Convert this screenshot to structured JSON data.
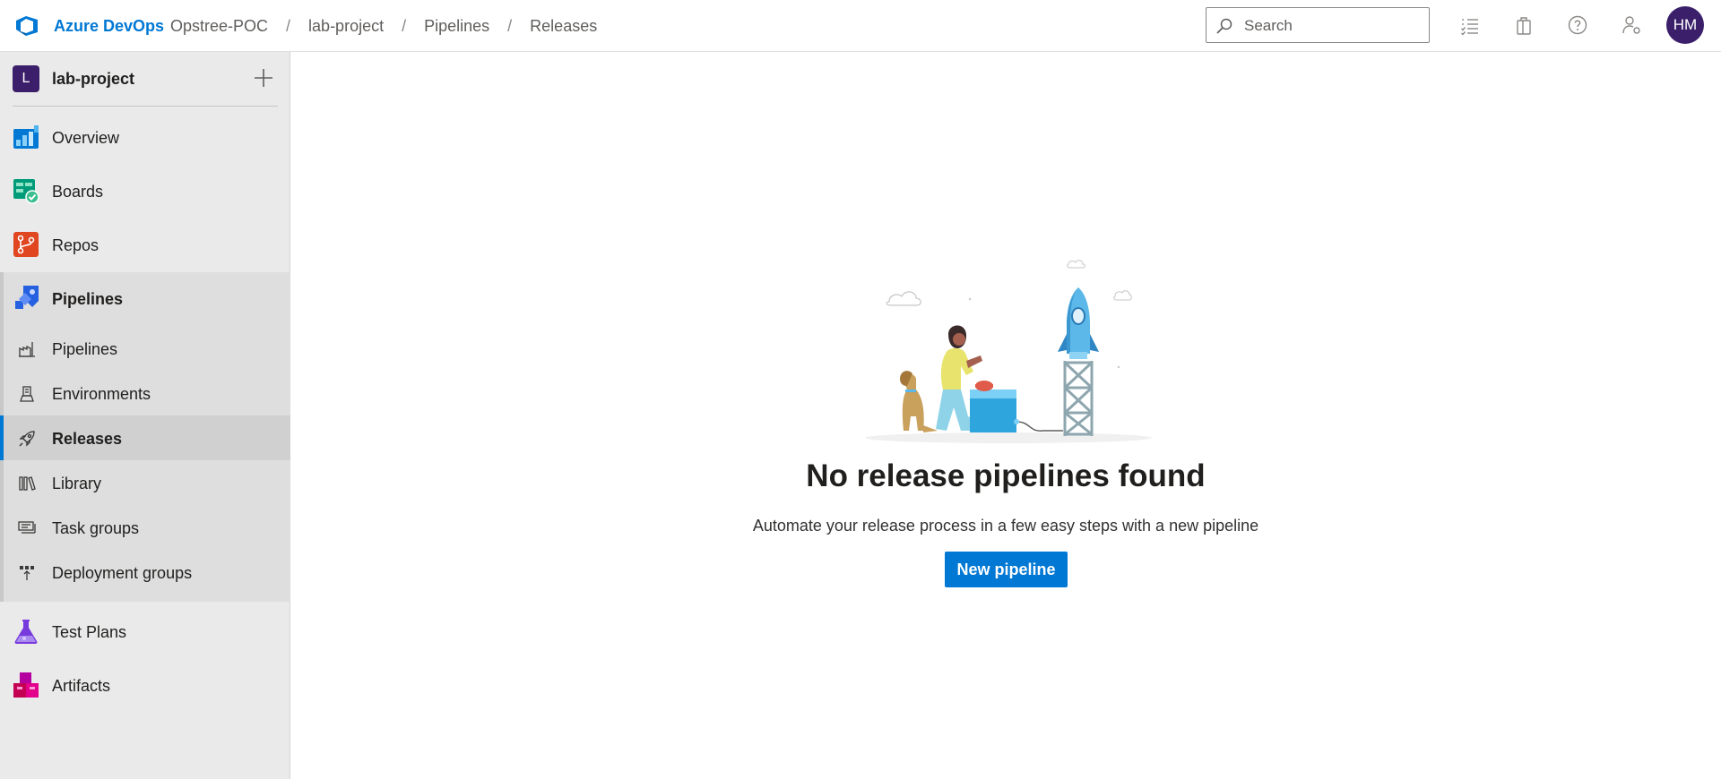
{
  "app": {
    "brand": "Azure DevOps",
    "accent_color": "#0078d4"
  },
  "breadcrumb": [
    "Opstree-POC",
    "lab-project",
    "Pipelines",
    "Releases"
  ],
  "search": {
    "placeholder": "Search",
    "value": ""
  },
  "header_icons": [
    "work-items-icon",
    "marketplace-bag-icon",
    "help-icon",
    "user-settings-icon"
  ],
  "user": {
    "initials": "HM"
  },
  "project": {
    "initial": "L",
    "name": "lab-project"
  },
  "sidebar": {
    "items": [
      {
        "label": "Overview",
        "icon": "overview-icon"
      },
      {
        "label": "Boards",
        "icon": "boards-icon"
      },
      {
        "label": "Repos",
        "icon": "repos-icon"
      },
      {
        "label": "Pipelines",
        "icon": "pipelines-icon",
        "expanded": true
      },
      {
        "label": "Test Plans",
        "icon": "test-plans-icon"
      },
      {
        "label": "Artifacts",
        "icon": "artifacts-icon"
      }
    ],
    "pipelines_sub": [
      {
        "label": "Pipelines",
        "icon": "pipelines-sub-icon"
      },
      {
        "label": "Environments",
        "icon": "environments-icon"
      },
      {
        "label": "Releases",
        "icon": "releases-rocket-icon",
        "selected": true
      },
      {
        "label": "Library",
        "icon": "library-icon"
      },
      {
        "label": "Task groups",
        "icon": "task-groups-icon"
      },
      {
        "label": "Deployment groups",
        "icon": "deployment-groups-icon"
      }
    ]
  },
  "main": {
    "empty_title": "No release pipelines found",
    "empty_subtitle": "Automate your release process in a few easy steps with a new pipeline",
    "new_pipeline_button": "New pipeline"
  }
}
